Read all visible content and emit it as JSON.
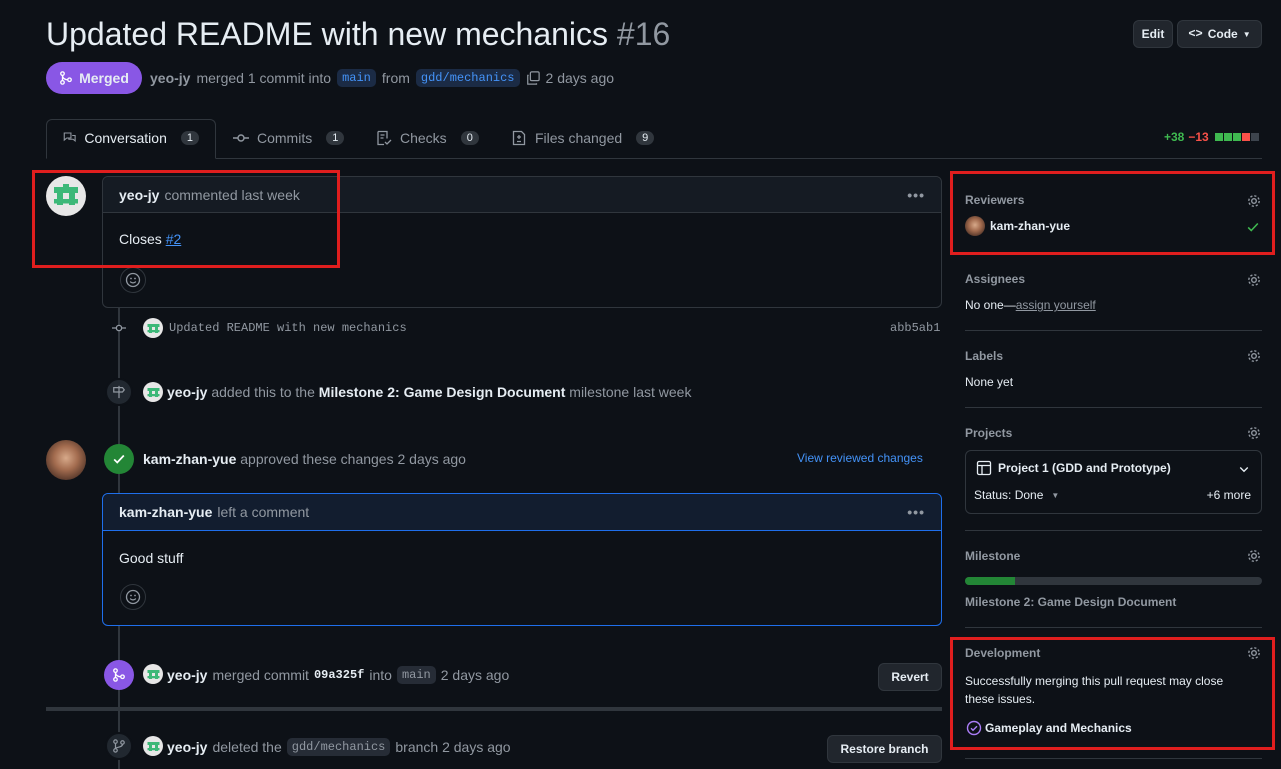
{
  "pr": {
    "title": "Updated README with new mechanics",
    "number": "#16",
    "state": "Merged",
    "author": "yeo-jy",
    "merge_text": "merged 1 commit into",
    "base_branch": "main",
    "from_text": "from",
    "head_branch": "gdd/mechanics",
    "time": "2 days ago"
  },
  "header_buttons": {
    "edit": "Edit",
    "code": "Code"
  },
  "tabs": [
    {
      "label": "Conversation",
      "count": "1"
    },
    {
      "label": "Commits",
      "count": "1"
    },
    {
      "label": "Checks",
      "count": "0"
    },
    {
      "label": "Files changed",
      "count": "9"
    }
  ],
  "diffstat": {
    "additions": "+38",
    "deletions": "−13"
  },
  "timeline": {
    "first_comment": {
      "author": "yeo-jy",
      "meta": "commented last week",
      "body_prefix": "Closes",
      "issue_link": "#2"
    },
    "commit": {
      "message": "Updated README with new mechanics",
      "sha": "abb5ab1"
    },
    "milestone_event": {
      "actor": "yeo-jy",
      "text1": "added this to the",
      "milestone": "Milestone 2: Game Design Document",
      "text2": "milestone last week"
    },
    "review": {
      "reviewer": "kam-zhan-yue",
      "text": "approved these changes 2 days ago",
      "link": "View reviewed changes"
    },
    "review_comment": {
      "author": "kam-zhan-yue",
      "meta": "left a comment",
      "body": "Good stuff"
    },
    "merge_event": {
      "actor": "yeo-jy",
      "text1": "merged commit",
      "sha": "09a325f",
      "text2": "into",
      "branch": "main",
      "time": "2 days ago",
      "button": "Revert"
    },
    "delete_event": {
      "actor": "yeo-jy",
      "text1": "deleted the",
      "branch": "gdd/mechanics",
      "text2": "branch 2 days ago",
      "button": "Restore branch"
    }
  },
  "sidebar": {
    "reviewers": {
      "title": "Reviewers",
      "name": "kam-zhan-yue"
    },
    "assignees": {
      "title": "Assignees",
      "none": "No one—",
      "link": "assign yourself"
    },
    "labels": {
      "title": "Labels",
      "value": "None yet"
    },
    "projects": {
      "title": "Projects",
      "project": "Project 1 (GDD and Prototype)",
      "status": "Status: Done",
      "more": "+6 more"
    },
    "milestone": {
      "title": "Milestone",
      "name": "Milestone 2: Game Design Document",
      "progress": 0.17
    },
    "development": {
      "title": "Development",
      "text": "Successfully merging this pull request may close these issues.",
      "issue": "Gameplay and Mechanics"
    }
  },
  "colors": {
    "merged": "#8957e5",
    "approved": "#238636",
    "additions": "#3fb950",
    "deletions": "#f85149",
    "link": "#4493f8",
    "highlight": "#e01e1e"
  }
}
